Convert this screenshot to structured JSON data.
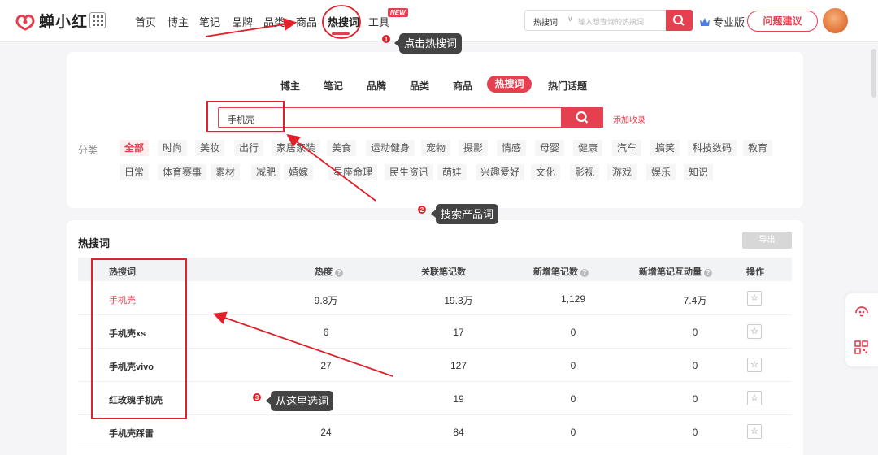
{
  "app": {
    "name": "蝉小红"
  },
  "nav": {
    "items": [
      "首页",
      "博主",
      "笔记",
      "品牌",
      "品类",
      "商品",
      "热搜词",
      "工具"
    ],
    "active": "热搜词",
    "new_badge": "NEW",
    "search_select": "热搜词",
    "search_placeholder": "输入想查询的热搜词",
    "pro_label": "专业版",
    "feedback_label": "问题建议"
  },
  "search_card": {
    "tabs": [
      "博主",
      "笔记",
      "品牌",
      "品类",
      "商品",
      "热搜词",
      "热门话题"
    ],
    "active_tab": "热搜词",
    "query": "手机壳",
    "add_link": "添加收录",
    "category_label": "分类",
    "categories_row1": [
      "全部",
      "时尚",
      "美妆",
      "出行",
      "家居家装",
      "美食",
      "运动健身",
      "宠物",
      "摄影",
      "情感",
      "母婴",
      "健康",
      "汽车",
      "搞笑",
      "科技数码",
      "教育"
    ],
    "categories_row2": [
      "日常",
      "体育赛事",
      "素材",
      "减肥",
      "婚嫁",
      "星座命理",
      "民生资讯",
      "萌娃",
      "兴趣爱好",
      "文化",
      "影视",
      "游戏",
      "娱乐",
      "知识"
    ],
    "active_category": "全部"
  },
  "table": {
    "title": "热搜词",
    "export_label": "导出",
    "columns": [
      "热搜词",
      "热度",
      "关联笔记数",
      "新增笔记数",
      "新增笔记互动量",
      "操作"
    ],
    "rows": [
      {
        "keyword": "手机壳",
        "heat": "9.8万",
        "related": "19.3万",
        "new_notes": "1,129",
        "interactions": "7.4万"
      },
      {
        "keyword": "手机壳xs",
        "heat": "6",
        "related": "17",
        "new_notes": "0",
        "interactions": "0"
      },
      {
        "keyword": "手机壳vivo",
        "heat": "27",
        "related": "127",
        "new_notes": "0",
        "interactions": "0"
      },
      {
        "keyword": "红玫瑰手机壳",
        "heat": "",
        "related": "19",
        "new_notes": "0",
        "interactions": "0"
      },
      {
        "keyword": "手机壳踩雷",
        "heat": "24",
        "related": "84",
        "new_notes": "0",
        "interactions": "0"
      }
    ]
  },
  "annotations": {
    "step1": {
      "num": "1",
      "text": "点击热搜词"
    },
    "step2": {
      "num": "2",
      "text": "搜索产品词"
    },
    "step3": {
      "num": "3",
      "text": "从这里选词"
    }
  },
  "colors": {
    "accent": "#e5404f",
    "annotation_red": "#e0202b",
    "tooltip_bg": "#444444"
  }
}
